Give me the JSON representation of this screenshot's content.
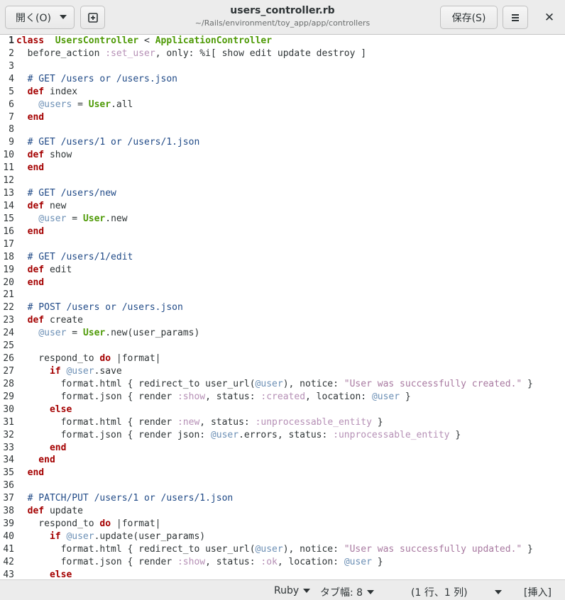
{
  "header": {
    "open_label": "開く(O)",
    "save_label": "保存(S)",
    "title": "users_controller.rb",
    "subtitle": "~/Rails/environment/toy_app/app/controllers",
    "close_glyph": "✕",
    "menu_glyph": "☰"
  },
  "editor": {
    "current_line": 1,
    "lines": [
      [
        [
          "kw",
          "class"
        ],
        [
          "",
          "  "
        ],
        [
          "cls",
          "UsersController"
        ],
        [
          "",
          " < "
        ],
        [
          "cls",
          "ApplicationController"
        ]
      ],
      [
        [
          "",
          "  before_action "
        ],
        [
          "sym",
          ":set_user"
        ],
        [
          "",
          ", only: %i[ show edit update destroy ]"
        ]
      ],
      [],
      [
        [
          "cm",
          "  # GET /users or /users.json"
        ]
      ],
      [
        [
          "kw",
          "  def"
        ],
        [
          "",
          " index"
        ]
      ],
      [
        [
          "iv",
          "    @users"
        ],
        [
          "",
          " = "
        ],
        [
          "cls",
          "User"
        ],
        [
          "",
          ".all"
        ]
      ],
      [
        [
          "kw",
          "  end"
        ]
      ],
      [],
      [
        [
          "cm",
          "  # GET /users/1 or /users/1.json"
        ]
      ],
      [
        [
          "kw",
          "  def"
        ],
        [
          "",
          " show"
        ]
      ],
      [
        [
          "kw",
          "  end"
        ]
      ],
      [],
      [
        [
          "cm",
          "  # GET /users/new"
        ]
      ],
      [
        [
          "kw",
          "  def"
        ],
        [
          "",
          " new"
        ]
      ],
      [
        [
          "iv",
          "    @user"
        ],
        [
          "",
          " = "
        ],
        [
          "cls",
          "User"
        ],
        [
          "",
          ".new"
        ]
      ],
      [
        [
          "kw",
          "  end"
        ]
      ],
      [],
      [
        [
          "cm",
          "  # GET /users/1/edit"
        ]
      ],
      [
        [
          "kw",
          "  def"
        ],
        [
          "",
          " edit"
        ]
      ],
      [
        [
          "kw",
          "  end"
        ]
      ],
      [],
      [
        [
          "cm",
          "  # POST /users or /users.json"
        ]
      ],
      [
        [
          "kw",
          "  def"
        ],
        [
          "",
          " create"
        ]
      ],
      [
        [
          "iv",
          "    @user"
        ],
        [
          "",
          " = "
        ],
        [
          "cls",
          "User"
        ],
        [
          "",
          ".new(user_params)"
        ]
      ],
      [],
      [
        [
          "",
          "    respond_to "
        ],
        [
          "kw",
          "do"
        ],
        [
          "",
          " |format|"
        ]
      ],
      [
        [
          "kw",
          "      if"
        ],
        [
          "",
          " "
        ],
        [
          "iv",
          "@user"
        ],
        [
          "",
          ".save"
        ]
      ],
      [
        [
          "",
          "        format.html { redirect_to user_url("
        ],
        [
          "iv",
          "@user"
        ],
        [
          "",
          "), notice: "
        ],
        [
          "str",
          "\"User was successfully created.\""
        ],
        [
          "",
          " }"
        ]
      ],
      [
        [
          "",
          "        format.json { render "
        ],
        [
          "sym",
          ":show"
        ],
        [
          "",
          ", status: "
        ],
        [
          "sym",
          ":created"
        ],
        [
          "",
          ", location: "
        ],
        [
          "iv",
          "@user"
        ],
        [
          "",
          " }"
        ]
      ],
      [
        [
          "kw",
          "      else"
        ]
      ],
      [
        [
          "",
          "        format.html { render "
        ],
        [
          "sym",
          ":new"
        ],
        [
          "",
          ", status: "
        ],
        [
          "sym",
          ":unprocessable_entity"
        ],
        [
          "",
          " }"
        ]
      ],
      [
        [
          "",
          "        format.json { render json: "
        ],
        [
          "iv",
          "@user"
        ],
        [
          "",
          ".errors, status: "
        ],
        [
          "sym",
          ":unprocessable_entity"
        ],
        [
          "",
          " }"
        ]
      ],
      [
        [
          "kw",
          "      end"
        ]
      ],
      [
        [
          "kw",
          "    end"
        ]
      ],
      [
        [
          "kw",
          "  end"
        ]
      ],
      [],
      [
        [
          "cm",
          "  # PATCH/PUT /users/1 or /users/1.json"
        ]
      ],
      [
        [
          "kw",
          "  def"
        ],
        [
          "",
          " update"
        ]
      ],
      [
        [
          "",
          "    respond_to "
        ],
        [
          "kw",
          "do"
        ],
        [
          "",
          " |format|"
        ]
      ],
      [
        [
          "kw",
          "      if"
        ],
        [
          "",
          " "
        ],
        [
          "iv",
          "@user"
        ],
        [
          "",
          ".update(user_params)"
        ]
      ],
      [
        [
          "",
          "        format.html { redirect_to user_url("
        ],
        [
          "iv",
          "@user"
        ],
        [
          "",
          "), notice: "
        ],
        [
          "str",
          "\"User was successfully updated.\""
        ],
        [
          "",
          " }"
        ]
      ],
      [
        [
          "",
          "        format.json { render "
        ],
        [
          "sym",
          ":show"
        ],
        [
          "",
          ", status: "
        ],
        [
          "sym",
          ":ok"
        ],
        [
          "",
          ", location: "
        ],
        [
          "iv",
          "@user"
        ],
        [
          "",
          " }"
        ]
      ],
      [
        [
          "kw",
          "      else"
        ]
      ]
    ]
  },
  "statusbar": {
    "language": "Ruby",
    "tab_width": "タブ幅: 8",
    "position": "(1 行、1 列)",
    "mode": "[挿入]"
  }
}
